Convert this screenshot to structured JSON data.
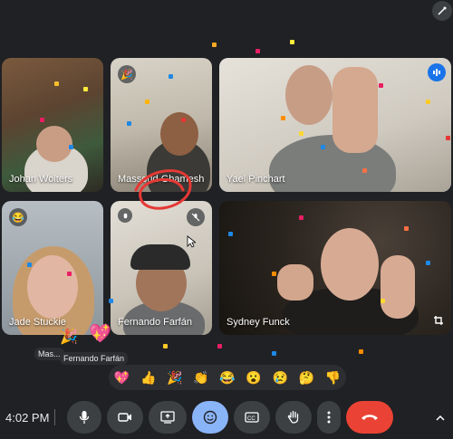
{
  "participants": [
    {
      "name": "Johan Wolters"
    },
    {
      "name": "Massoud Ghamesh"
    },
    {
      "name": "Yael Pinchart"
    },
    {
      "name": "Jade Stuckie"
    },
    {
      "name": "Fernando Farfán"
    },
    {
      "name": "Sydney Funck"
    }
  ],
  "popup_labels": {
    "first": "Mas...",
    "second": "Fernando Farfán"
  },
  "reactions": [
    "💖",
    "👍",
    "🎉",
    "👏",
    "😂",
    "😮",
    "😢",
    "🤔",
    "👎"
  ],
  "badges": {
    "jade_reaction": "😂",
    "massoud_reaction": "🎉"
  },
  "clock": "4:02 PM",
  "colors": {
    "accent": "#8ab4f8",
    "end_call": "#ea4335",
    "active_reactions": "#8ab4f8"
  }
}
